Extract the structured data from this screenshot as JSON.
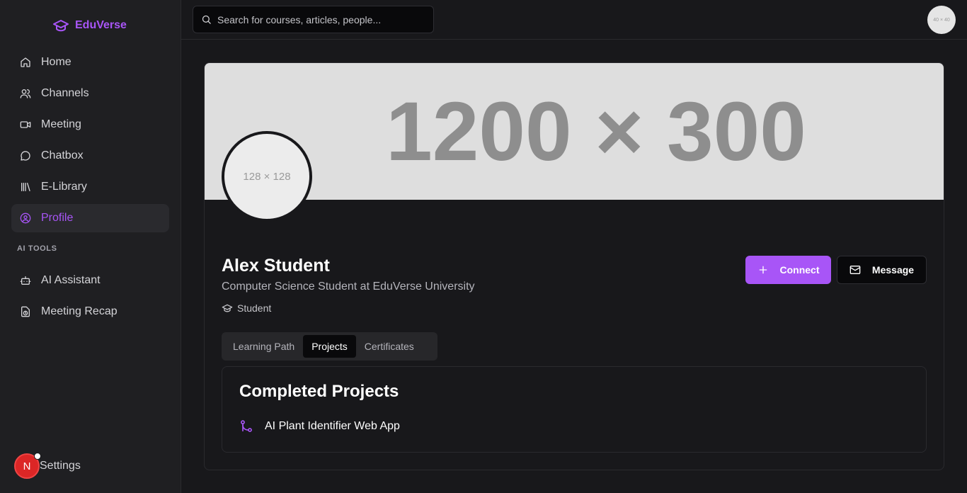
{
  "brand": {
    "name": "EduVerse",
    "accent_color": "#a855f7"
  },
  "sidebar": {
    "items": [
      {
        "label": "Home",
        "icon": "home-icon"
      },
      {
        "label": "Channels",
        "icon": "users-icon"
      },
      {
        "label": "Meeting",
        "icon": "video-icon"
      },
      {
        "label": "Chatbox",
        "icon": "chat-icon"
      },
      {
        "label": "E-Library",
        "icon": "library-icon"
      },
      {
        "label": "Profile",
        "icon": "user-circle-icon",
        "active": true
      }
    ],
    "section_label": "AI TOOLS",
    "ai_items": [
      {
        "label": "AI Assistant",
        "icon": "bot-icon"
      },
      {
        "label": "Meeting Recap",
        "icon": "recap-icon"
      }
    ],
    "settings_label": "Settings",
    "avatar_letter": "N"
  },
  "header": {
    "search_placeholder": "Search for courses, articles, people...",
    "avatar_placeholder": "40 × 40"
  },
  "profile": {
    "banner_placeholder": "1200 × 300",
    "avatar_placeholder": "128 × 128",
    "name": "Alex Student",
    "headline": "Computer Science Student at EduVerse University",
    "role": "Student",
    "connect_label": "Connect",
    "message_label": "Message"
  },
  "tabs": [
    {
      "label": "Learning Path"
    },
    {
      "label": "Projects",
      "active": true
    },
    {
      "label": "Certificates"
    }
  ],
  "panel": {
    "title": "Completed Projects",
    "projects": [
      {
        "label": "AI Plant Identifier Web App"
      }
    ]
  }
}
